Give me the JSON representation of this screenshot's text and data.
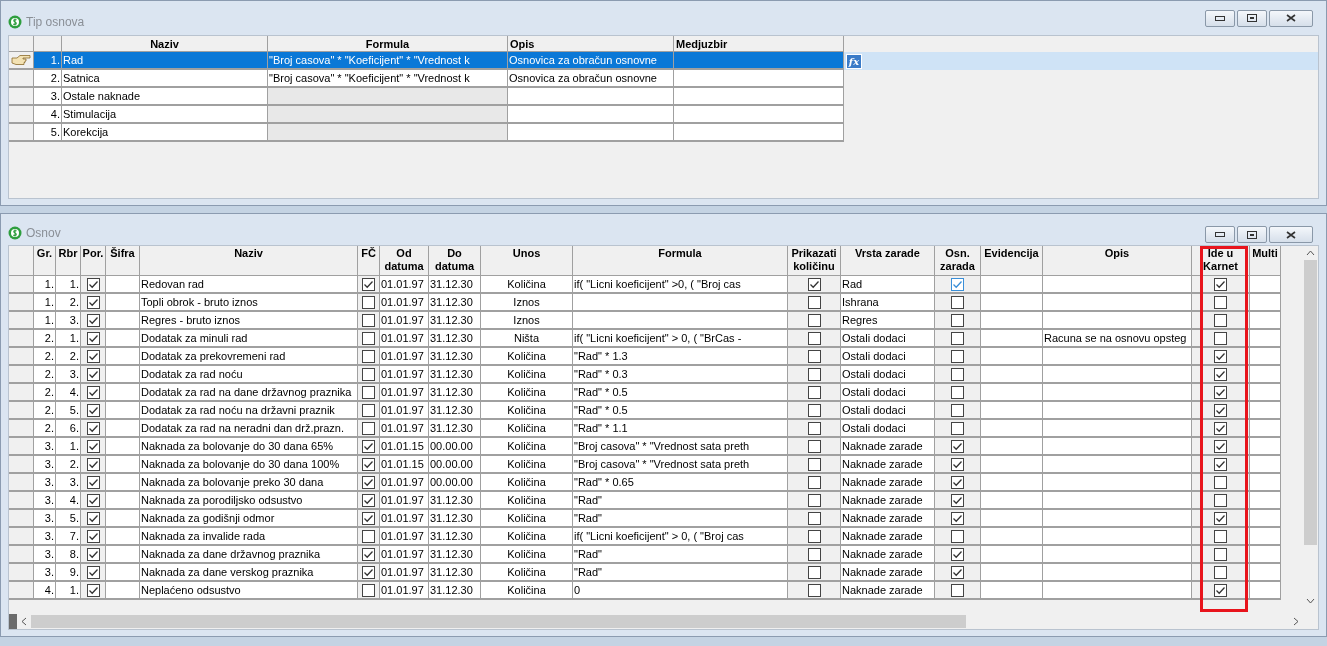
{
  "tip_osnova": {
    "title": "Tip osnova",
    "formula_button": "fx",
    "columns": [
      "Naziv",
      "Formula",
      "Opis",
      "Medjuzbir"
    ],
    "rows": [
      {
        "number": "1.",
        "naziv": "Rad",
        "formula": "\"Broj casova\" *  \"Koeficijent\" *  \"Vrednost k",
        "opis": "Osnovica za obračun osnovne",
        "formula_disabled": false,
        "selected": true
      },
      {
        "number": "2.",
        "naziv": "Satnica",
        "formula": "\"Broj casova\" *  \"Koeficijent\" *  \"Vrednost k",
        "opis": "Osnovica za obračun osnovne",
        "formula_disabled": false,
        "selected": false
      },
      {
        "number": "3.",
        "naziv": "Ostale naknade",
        "formula_disabled": true,
        "selected": false
      },
      {
        "number": "4.",
        "naziv": "Stimulacija",
        "formula_disabled": true,
        "selected": false
      },
      {
        "number": "5.",
        "naziv": "Korekcija",
        "formula_disabled": true,
        "selected": false
      }
    ]
  },
  "osnov": {
    "title": "Osnov",
    "columns": [
      {
        "label": "Gr.",
        "highlighted": false
      },
      {
        "label": "Rbr",
        "highlighted": false
      },
      {
        "label": "Por.",
        "highlighted": false
      },
      {
        "label": "Šifra",
        "highlighted": false
      },
      {
        "label": "Naziv",
        "highlighted": false
      },
      {
        "label": "FČ",
        "highlighted": false
      },
      {
        "label": "Od datuma",
        "highlighted": false
      },
      {
        "label": "Do datuma",
        "highlighted": false
      },
      {
        "label": "Unos",
        "highlighted": false
      },
      {
        "label": "Formula",
        "highlighted": false
      },
      {
        "label": "Prikazati količinu",
        "highlighted": false
      },
      {
        "label": "Vrsta zarade",
        "highlighted": false
      },
      {
        "label": "Osn. zarada",
        "highlighted": false
      },
      {
        "label": "Evidencija",
        "highlighted": false
      },
      {
        "label": "Opis",
        "highlighted": false
      },
      {
        "label": "Ide u Karnet",
        "highlighted": true
      },
      {
        "label": "Multi",
        "highlighted": false
      }
    ],
    "rows": [
      {
        "gr": "1.",
        "rbr": "1.",
        "por": true,
        "naziv": "Redovan rad",
        "fc": true,
        "od": "01.01.97",
        "do": "31.12.30",
        "unos": "Količina",
        "formula": "if(  \"Licni koeficijent\" >0, (  \"Broj cas",
        "prikazati": true,
        "vrsta": "Rad",
        "osn": true,
        "karnet": true
      },
      {
        "gr": "1.",
        "rbr": "2.",
        "por": true,
        "naziv": "Topli obrok - bruto iznos",
        "fc": false,
        "od": "01.01.97",
        "do": "31.12.30",
        "unos": "Iznos",
        "prikazati": false,
        "vrsta": "Ishrana",
        "osn": false,
        "karnet": false
      },
      {
        "gr": "1.",
        "rbr": "3.",
        "por": true,
        "naziv": "Regres - bruto iznos",
        "fc": false,
        "od": "01.01.97",
        "do": "31.12.30",
        "unos": "Iznos",
        "prikazati": false,
        "vrsta": "Regres",
        "osn": false,
        "karnet": false
      },
      {
        "gr": "2.",
        "rbr": "1.",
        "por": true,
        "naziv": "Dodatak za minuli rad",
        "fc": false,
        "od": "01.01.97",
        "do": "31.12.30",
        "unos": "Ništa",
        "formula": "if( \"Licni koeficijent\"  > 0, (  \"BrCas -",
        "prikazati": false,
        "vrsta": "Ostali dodaci",
        "osn": false,
        "opis": "Racuna se na osnovu opsteg",
        "karnet": false
      },
      {
        "gr": "2.",
        "rbr": "2.",
        "por": true,
        "naziv": "Dodatak za prekovremeni rad",
        "fc": false,
        "od": "01.01.97",
        "do": "31.12.30",
        "unos": "Količina",
        "formula": "\"Rad\" * 1.3",
        "prikazati": false,
        "vrsta": "Ostali dodaci",
        "osn": false,
        "karnet": true
      },
      {
        "gr": "2.",
        "rbr": "3.",
        "por": true,
        "naziv": "Dodatak za rad noću",
        "fc": false,
        "od": "01.01.97",
        "do": "31.12.30",
        "unos": "Količina",
        "formula": "\"Rad\" * 0.3",
        "prikazati": false,
        "vrsta": "Ostali dodaci",
        "osn": false,
        "karnet": true
      },
      {
        "gr": "2.",
        "rbr": "4.",
        "por": true,
        "naziv": "Dodatak za rad na dane državnog praznika",
        "fc": false,
        "od": "01.01.97",
        "do": "31.12.30",
        "unos": "Količina",
        "formula": "\"Rad\" * 0.5",
        "prikazati": false,
        "vrsta": "Ostali dodaci",
        "osn": false,
        "karnet": true
      },
      {
        "gr": "2.",
        "rbr": "5.",
        "por": true,
        "naziv": "Dodatak za rad noću na državni praznik",
        "fc": false,
        "od": "01.01.97",
        "do": "31.12.30",
        "unos": "Količina",
        "formula": "\"Rad\" * 0.5",
        "prikazati": false,
        "vrsta": "Ostali dodaci",
        "osn": false,
        "karnet": true
      },
      {
        "gr": "2.",
        "rbr": "6.",
        "por": true,
        "naziv": "Dodatak za rad na neradni dan drž.prazn.",
        "fc": false,
        "od": "01.01.97",
        "do": "31.12.30",
        "unos": "Količina",
        "formula": "\"Rad\" * 1.1",
        "prikazati": false,
        "vrsta": "Ostali dodaci",
        "osn": false,
        "karnet": true
      },
      {
        "gr": "3.",
        "rbr": "1.",
        "por": true,
        "naziv": "Naknada za bolovanje do 30 dana 65%",
        "fc": true,
        "od": "01.01.15",
        "do": "00.00.00",
        "unos": "Količina",
        "formula": "\"Broj casova\" * \"Vrednost sata preth",
        "prikazati": false,
        "vrsta": "Naknade zarade",
        "osn": true,
        "karnet": true
      },
      {
        "gr": "3.",
        "rbr": "2.",
        "por": true,
        "naziv": "Naknada za bolovanje do 30 dana 100%",
        "fc": true,
        "od": "01.01.15",
        "do": "00.00.00",
        "unos": "Količina",
        "formula": "\"Broj casova\" * \"Vrednost sata preth",
        "prikazati": false,
        "vrsta": "Naknade zarade",
        "osn": true,
        "karnet": true
      },
      {
        "gr": "3.",
        "rbr": "3.",
        "por": true,
        "naziv": "Naknada za bolovanje preko 30 dana",
        "fc": true,
        "od": "01.01.97",
        "do": "00.00.00",
        "unos": "Količina",
        "formula": "\"Rad\" * 0.65",
        "prikazati": false,
        "vrsta": "Naknade zarade",
        "osn": true,
        "karnet": false
      },
      {
        "gr": "3.",
        "rbr": "4.",
        "por": true,
        "naziv": "Naknada za porodiljsko odsustvo",
        "fc": true,
        "od": "01.01.97",
        "do": "31.12.30",
        "unos": "Količina",
        "formula": "\"Rad\"",
        "prikazati": false,
        "vrsta": "Naknade zarade",
        "osn": true,
        "karnet": false
      },
      {
        "gr": "3.",
        "rbr": "5.",
        "por": true,
        "naziv": "Naknada za godišnji odmor",
        "fc": true,
        "od": "01.01.97",
        "do": "31.12.30",
        "unos": "Količina",
        "formula": "\"Rad\"",
        "prikazati": false,
        "vrsta": "Naknade zarade",
        "osn": true,
        "karnet": true
      },
      {
        "gr": "3.",
        "rbr": "7.",
        "por": true,
        "naziv": "Naknada za invalide rada",
        "fc": false,
        "od": "01.01.97",
        "do": "31.12.30",
        "unos": "Količina",
        "formula": "if( \"Licni koeficijent\"  > 0, (  \"Broj cas",
        "prikazati": false,
        "vrsta": "Naknade zarade",
        "osn": false,
        "karnet": false
      },
      {
        "gr": "3.",
        "rbr": "8.",
        "por": true,
        "naziv": "Naknada za dane državnog praznika",
        "fc": true,
        "od": "01.01.97",
        "do": "31.12.30",
        "unos": "Količina",
        "formula": "\"Rad\"",
        "prikazati": false,
        "vrsta": "Naknade zarade",
        "osn": true,
        "karnet": false
      },
      {
        "gr": "3.",
        "rbr": "9.",
        "por": true,
        "naziv": "Naknada za dane verskog praznika",
        "fc": true,
        "od": "01.01.97",
        "do": "31.12.30",
        "unos": "Količina",
        "formula": "\"Rad\"",
        "prikazati": false,
        "vrsta": "Naknade zarade",
        "osn": true,
        "karnet": false
      },
      {
        "gr": "4.",
        "rbr": "1.",
        "por": true,
        "naziv": "Neplaćeno odsustvo",
        "fc": false,
        "od": "01.01.97",
        "do": "31.12.30",
        "unos": "Količina",
        "formula": "0",
        "prikazati": false,
        "vrsta": "Naknade zarade",
        "osn": false,
        "karnet": true
      }
    ]
  }
}
